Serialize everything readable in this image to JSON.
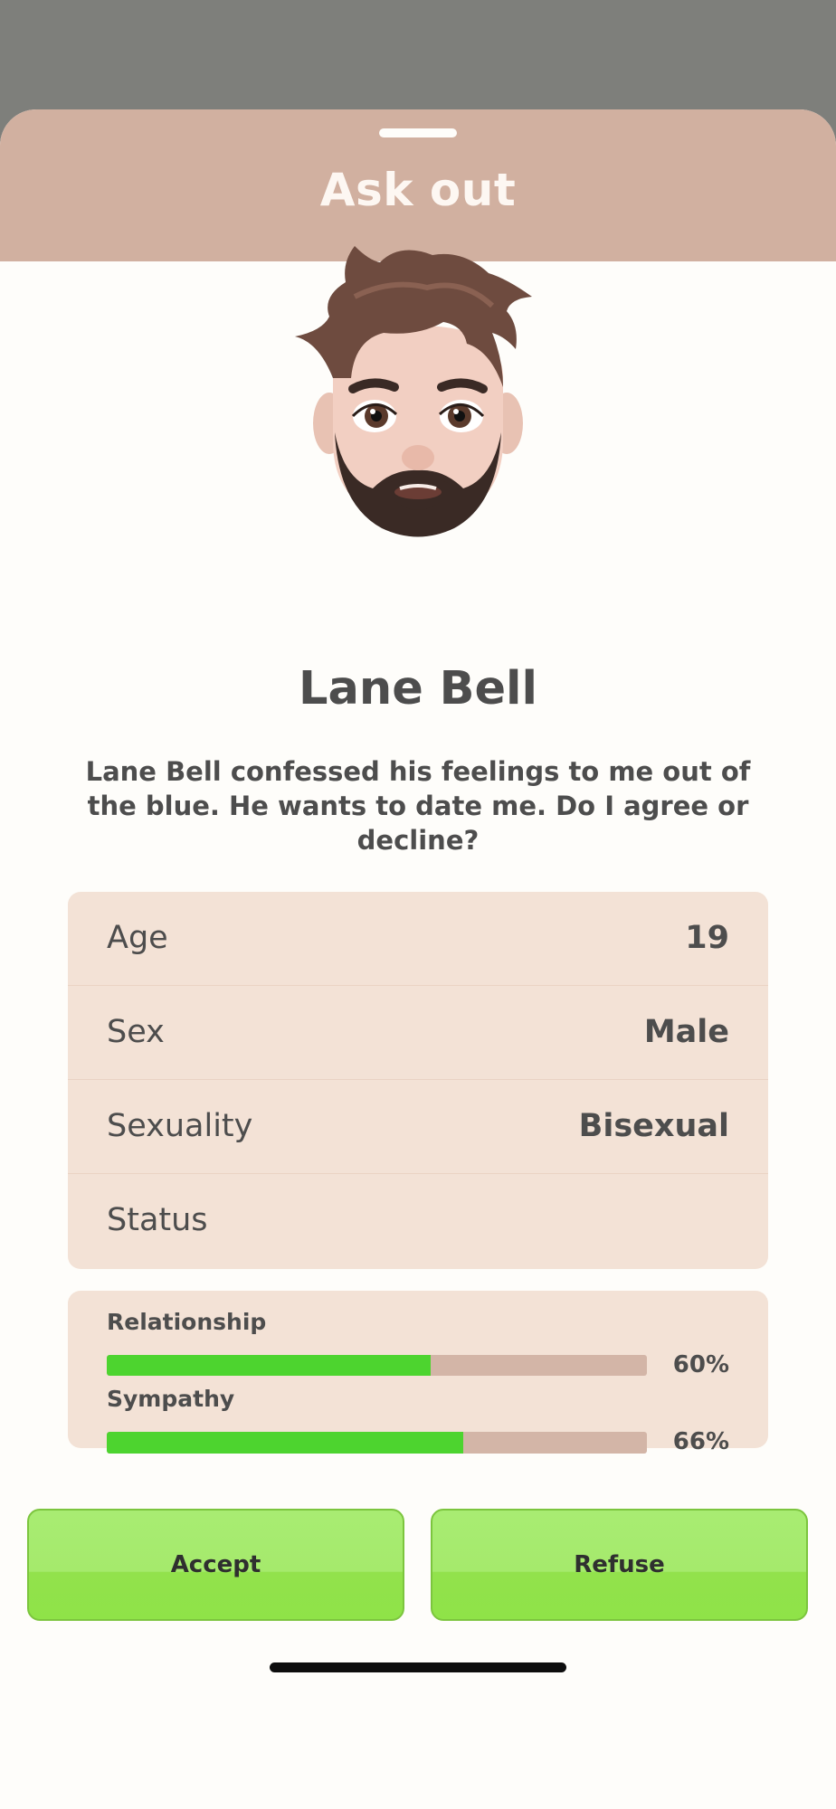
{
  "sheet": {
    "title": "Ask out"
  },
  "profile": {
    "name": "Lane Bell",
    "description": "Lane Bell confessed his feelings to me out of the blue. He wants to date me. Do I agree or decline?"
  },
  "info": [
    {
      "label": "Age",
      "value": "19"
    },
    {
      "label": "Sex",
      "value": "Male"
    },
    {
      "label": "Sexuality",
      "value": "Bisexual"
    },
    {
      "label": "Status",
      "value": ""
    }
  ],
  "stats": [
    {
      "label": "Relationship",
      "percent_text": "60%",
      "value": 0.6
    },
    {
      "label": "Sympathy",
      "percent_text": "66%",
      "value": 0.66
    }
  ],
  "actions": {
    "accept_label": "Accept",
    "refuse_label": "Refuse"
  },
  "icons": {
    "avatar": "bearded-man-memoji-avatar"
  },
  "colors": {
    "header": "#d1b0a0",
    "card": "#f3e2d6",
    "bar_fill": "#4dd42f",
    "bar_track": "#d3b5a7",
    "button": "#9be85d",
    "text": "#4d4d4d"
  }
}
